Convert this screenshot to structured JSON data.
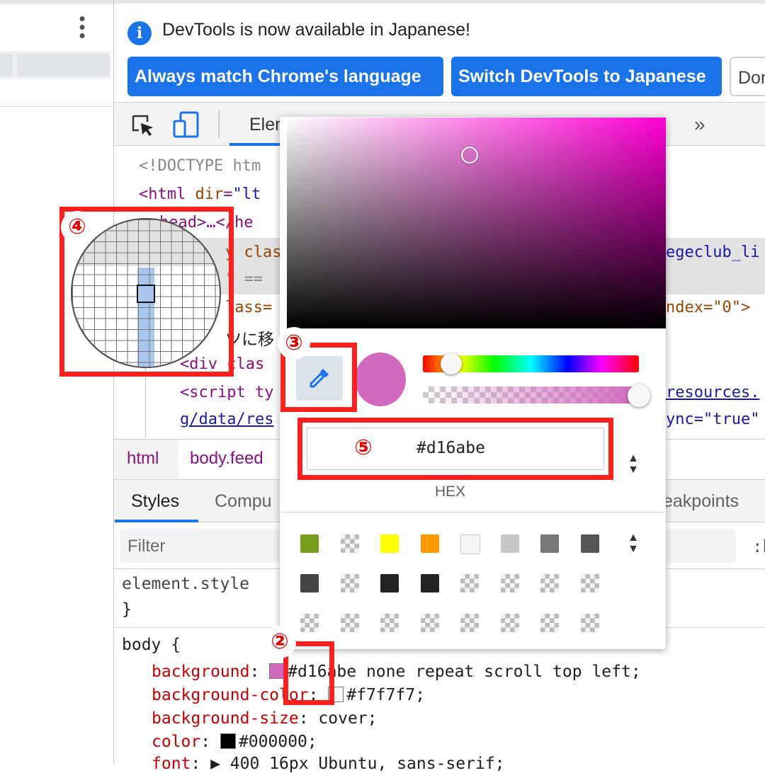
{
  "banner": {
    "message": "DevTools is now available in Japanese!",
    "info_icon": "i",
    "buttons": {
      "always_match": "Always match Chrome's language",
      "switch": "Switch DevTools to Japanese",
      "dont": "Don"
    }
  },
  "toolbar": {
    "elements_tab": "Elem",
    "overflow": "»"
  },
  "dom": {
    "doctype": "<!DOCTYPE htm",
    "html_open_tag": "<html ",
    "html_attr": "dir",
    "html_attr_val": "\"lt",
    "head_tag": "head>",
    "head_rest": "…</he",
    "body_frag": "y class",
    "body_val_frag": "egeclub_li",
    "pseudo_frag": "\" == ",
    "class_frag": "lass=",
    "tabindex_frag": "ndex=\"0\">",
    "japanese_text": "ツに移",
    "div_frag": "<div clas",
    "script_frag": "<script ty",
    "resources_link": "resources.",
    "data_link": "g/data/res",
    "async_frag": "ync=\"true\""
  },
  "crumbs": {
    "html": "html",
    "body": "body.feed"
  },
  "subtabs": {
    "styles": "Styles",
    "computed": "Compu",
    "breakpoints": "eakpoints"
  },
  "filter": {
    "placeholder": "Filter",
    "cls": ":h"
  },
  "styles": {
    "element_style": "element.style ",
    "close_brace": "}",
    "body_selector": "body {",
    "rules": [
      {
        "prop": "background",
        "value": "#d16abe none repeat scroll top left;",
        "swatch": "#d16abe"
      },
      {
        "prop": "background-color",
        "value": "#f7f7f7;",
        "swatch": "#f7f7f7"
      },
      {
        "prop": "background-size",
        "value": "cover;"
      },
      {
        "prop": "color",
        "value": "#000000;",
        "swatch": "#000000"
      },
      {
        "prop": "font",
        "value": "▶ 400 16px Ubuntu, sans-serif;"
      }
    ]
  },
  "picker": {
    "hex_value": "#d16abe",
    "hex_label": "HEX",
    "current_color": "#d16abe",
    "hue": 311,
    "alpha": 1.0,
    "eyedropper_icon": "eyedropper-icon",
    "palette": [
      [
        "#76a01b",
        "chk",
        "#ffff00",
        "#ff9900",
        "#f4f4f4",
        "#c7c7c7",
        "#777777",
        "#555555"
      ],
      [
        "#444444",
        "chk",
        "#222222",
        "#222222",
        "chk",
        "chk",
        "chk",
        "chk"
      ],
      [
        "chk",
        "chk",
        "chk",
        "chk",
        "chk",
        "chk",
        "chk",
        "chk"
      ]
    ]
  },
  "annotations": {
    "two": "②",
    "three": "③",
    "four": "④",
    "five": "⑤"
  }
}
